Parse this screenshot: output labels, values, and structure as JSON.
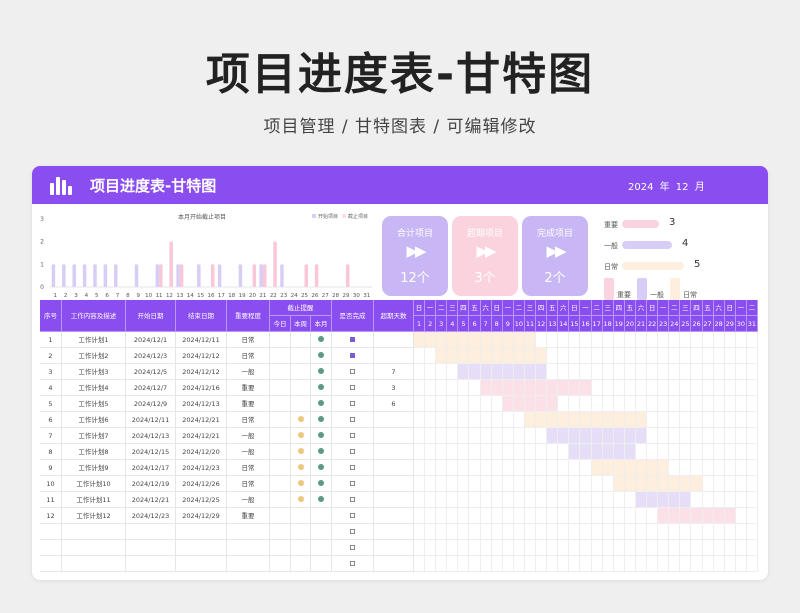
{
  "hero": {
    "title": "项目进度表-甘特图",
    "subtitle": "项目管理 / 甘特图表 / 可编辑修改"
  },
  "header": {
    "title": "项目进度表-甘特图",
    "date": "2024 年 12 月"
  },
  "colors": {
    "purple": "#8a4df0",
    "light_purple": "#d8cdf6",
    "pink": "#fce0e8",
    "peach": "#fdeedd",
    "green": "#5a9a86",
    "yellow": "#efc77d"
  },
  "mini_chart": {
    "title": "本月开始截止项目",
    "legend": [
      "开始项目",
      "截止项目"
    ],
    "y_ticks": [
      "0",
      "1",
      "2",
      "3"
    ],
    "days": [
      "1",
      "2",
      "3",
      "4",
      "5",
      "6",
      "7",
      "8",
      "9",
      "10",
      "11",
      "12",
      "13",
      "14",
      "15",
      "16",
      "17",
      "18",
      "19",
      "20",
      "21",
      "22",
      "23",
      "24",
      "25",
      "26",
      "27",
      "28",
      "29",
      "30",
      "31"
    ]
  },
  "chart_data": {
    "type": "bar",
    "title": "本月开始截止项目",
    "ylim": [
      0,
      3
    ],
    "categories": [
      "1",
      "2",
      "3",
      "4",
      "5",
      "6",
      "7",
      "8",
      "9",
      "10",
      "11",
      "12",
      "13",
      "14",
      "15",
      "16",
      "17",
      "18",
      "19",
      "20",
      "21",
      "22",
      "23",
      "24",
      "25",
      "26",
      "27",
      "28",
      "29",
      "30",
      "31"
    ],
    "series": [
      {
        "name": "开始项目",
        "values": [
          1,
          1,
          1,
          1,
          1,
          1,
          1,
          0,
          1,
          0,
          1,
          0,
          1,
          0,
          1,
          0,
          1,
          0,
          1,
          0,
          1,
          0,
          1,
          0,
          0,
          0,
          0,
          0,
          0,
          0,
          0
        ]
      },
      {
        "name": "截止项目",
        "values": [
          0,
          0,
          0,
          0,
          0,
          0,
          0,
          0,
          0,
          0,
          1,
          2,
          1,
          0,
          0,
          1,
          0,
          0,
          0,
          1,
          1,
          2,
          0,
          0,
          1,
          1,
          0,
          0,
          1,
          0,
          0
        ]
      }
    ]
  },
  "summary": [
    {
      "label": "合计项目",
      "value": "12个"
    },
    {
      "label": "超期项目",
      "value": "3个"
    },
    {
      "label": "完成项目",
      "value": "2个"
    }
  ],
  "importance_legend": {
    "rows": [
      {
        "label": "重要",
        "value": "3",
        "fill": 0.6
      },
      {
        "label": "一般",
        "value": "4",
        "fill": 0.8
      },
      {
        "label": "日常",
        "value": "5",
        "fill": 1.0
      }
    ],
    "swatches": [
      "重要",
      "一般",
      "日常"
    ]
  },
  "table": {
    "headers": {
      "seq": "序号",
      "name": "工作内容及描述",
      "start": "开始日期",
      "end": "结束日期",
      "level": "重要程度",
      "remind": "截止提醒",
      "today": "今日",
      "week": "本周",
      "month": "本月",
      "done": "是否完成",
      "overdue": "超期天数"
    },
    "weekdays": [
      "日",
      "一",
      "二",
      "三",
      "四",
      "五",
      "六",
      "日",
      "一",
      "二",
      "三",
      "四",
      "五",
      "六",
      "日",
      "一",
      "二",
      "三",
      "四",
      "五",
      "六",
      "日",
      "一",
      "二",
      "三",
      "四",
      "五",
      "六",
      "日",
      "一",
      "二"
    ],
    "days": [
      "1",
      "2",
      "3",
      "4",
      "5",
      "6",
      "7",
      "8",
      "9",
      "10",
      "11",
      "12",
      "13",
      "14",
      "15",
      "16",
      "17",
      "18",
      "19",
      "20",
      "21",
      "22",
      "23",
      "24",
      "25",
      "26",
      "27",
      "28",
      "29",
      "30",
      "31"
    ],
    "rows": [
      {
        "seq": "1",
        "name": "工作计划1",
        "start": "2024/12/1",
        "end": "2024/12/11",
        "level": "日常",
        "week": "",
        "month": "green",
        "done": "☑",
        "overdue": "",
        "s": 1,
        "e": 11
      },
      {
        "seq": "2",
        "name": "工作计划2",
        "start": "2024/12/3",
        "end": "2024/12/12",
        "level": "日常",
        "week": "",
        "month": "green",
        "done": "☑",
        "overdue": "",
        "s": 3,
        "e": 12
      },
      {
        "seq": "3",
        "name": "工作计划3",
        "start": "2024/12/5",
        "end": "2024/12/12",
        "level": "一般",
        "week": "",
        "month": "green",
        "done": "☐",
        "overdue": "7",
        "s": 5,
        "e": 12
      },
      {
        "seq": "4",
        "name": "工作计划4",
        "start": "2024/12/7",
        "end": "2024/12/16",
        "level": "重要",
        "week": "",
        "month": "green",
        "done": "☐",
        "overdue": "3",
        "s": 7,
        "e": 16
      },
      {
        "seq": "5",
        "name": "工作计划5",
        "start": "2024/12/9",
        "end": "2024/12/13",
        "level": "重要",
        "week": "",
        "month": "green",
        "done": "☐",
        "overdue": "6",
        "s": 9,
        "e": 13
      },
      {
        "seq": "6",
        "name": "工作计划6",
        "start": "2024/12/11",
        "end": "2024/12/21",
        "level": "日常",
        "week": "yellow",
        "month": "green",
        "done": "☐",
        "overdue": "",
        "s": 11,
        "e": 21
      },
      {
        "seq": "7",
        "name": "工作计划7",
        "start": "2024/12/13",
        "end": "2024/12/21",
        "level": "一般",
        "week": "yellow",
        "month": "green",
        "done": "☐",
        "overdue": "",
        "s": 13,
        "e": 21
      },
      {
        "seq": "8",
        "name": "工作计划8",
        "start": "2024/12/15",
        "end": "2024/12/20",
        "level": "一般",
        "week": "yellow",
        "month": "green",
        "done": "☐",
        "overdue": "",
        "s": 15,
        "e": 20
      },
      {
        "seq": "9",
        "name": "工作计划9",
        "start": "2024/12/17",
        "end": "2024/12/23",
        "level": "日常",
        "week": "yellow",
        "month": "green",
        "done": "☐",
        "overdue": "",
        "s": 17,
        "e": 23
      },
      {
        "seq": "10",
        "name": "工作计划10",
        "start": "2024/12/19",
        "end": "2024/12/26",
        "level": "日常",
        "week": "yellow",
        "month": "green",
        "done": "☐",
        "overdue": "",
        "s": 19,
        "e": 26
      },
      {
        "seq": "11",
        "name": "工作计划11",
        "start": "2024/12/21",
        "end": "2024/12/25",
        "level": "一般",
        "week": "yellow",
        "month": "green",
        "done": "☐",
        "overdue": "",
        "s": 21,
        "e": 25
      },
      {
        "seq": "12",
        "name": "工作计划12",
        "start": "2024/12/23",
        "end": "2024/12/29",
        "level": "重要",
        "week": "",
        "month": "",
        "done": "☐",
        "overdue": "",
        "s": 23,
        "e": 29
      },
      {
        "seq": "",
        "name": "",
        "start": "",
        "end": "",
        "level": "",
        "week": "",
        "month": "",
        "done": "☐",
        "overdue": "",
        "s": 0,
        "e": 0
      },
      {
        "seq": "",
        "name": "",
        "start": "",
        "end": "",
        "level": "",
        "week": "",
        "month": "",
        "done": "☐",
        "overdue": "",
        "s": 0,
        "e": 0
      },
      {
        "seq": "",
        "name": "",
        "start": "",
        "end": "",
        "level": "",
        "week": "",
        "month": "",
        "done": "☐",
        "overdue": "",
        "s": 0,
        "e": 0
      }
    ]
  }
}
